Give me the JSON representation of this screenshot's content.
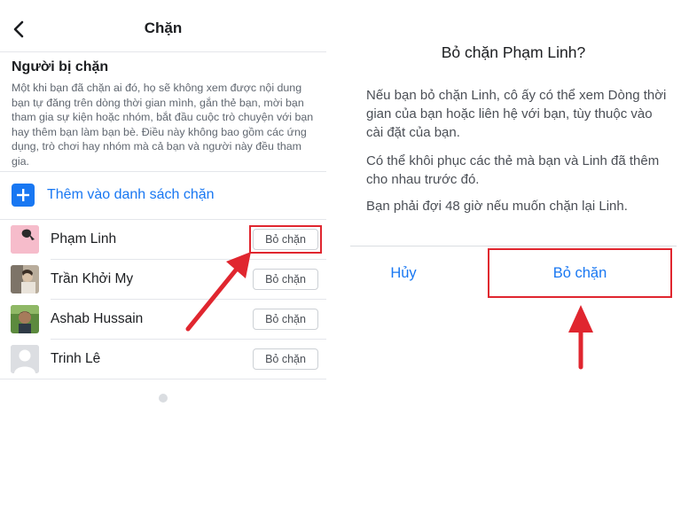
{
  "left": {
    "nav_title": "Chặn",
    "back_icon": "chevron-left-icon",
    "section_title": "Người bị chặn",
    "description": "Một khi bạn đã chặn ai đó, họ sẽ không xem được nội dung bạn tự đăng trên dòng thời gian mình, gắn thẻ bạn, mời bạn tham gia sự kiện hoặc nhóm, bắt đầu cuộc trò chuyện với bạn hay thêm bạn làm bạn bè. Điều này không bao gồm các ứng dụng, trò chơi hay nhóm mà cả bạn và người này đều tham gia.",
    "add_label": "Thêm vào danh sách chặn",
    "blocked_users": [
      {
        "name": "Phạm Linh",
        "button": "Bỏ chặn"
      },
      {
        "name": "Trần Khởi My",
        "button": "Bỏ chặn"
      },
      {
        "name": "Ashab Hussain",
        "button": "Bỏ chặn"
      },
      {
        "name": "Trinh Lê",
        "button": "Bỏ chặn"
      }
    ]
  },
  "dialog": {
    "title": "Bỏ chặn Phạm Linh?",
    "paragraphs": [
      "Nếu bạn bỏ chặn Linh, cô ấy có thể xem Dòng thời gian của bạn hoặc liên hệ với bạn, tùy thuộc vào cài đặt của bạn.",
      "Có thể khôi phục các thẻ mà bạn và Linh đã thêm cho nhau trước đó.",
      "Bạn phải đợi 48 giờ nếu muốn chặn lại Linh."
    ],
    "cancel_label": "Hủy",
    "confirm_label": "Bỏ chặn"
  },
  "colors": {
    "accent": "#1877f2",
    "annotation_red": "#e0262f"
  }
}
